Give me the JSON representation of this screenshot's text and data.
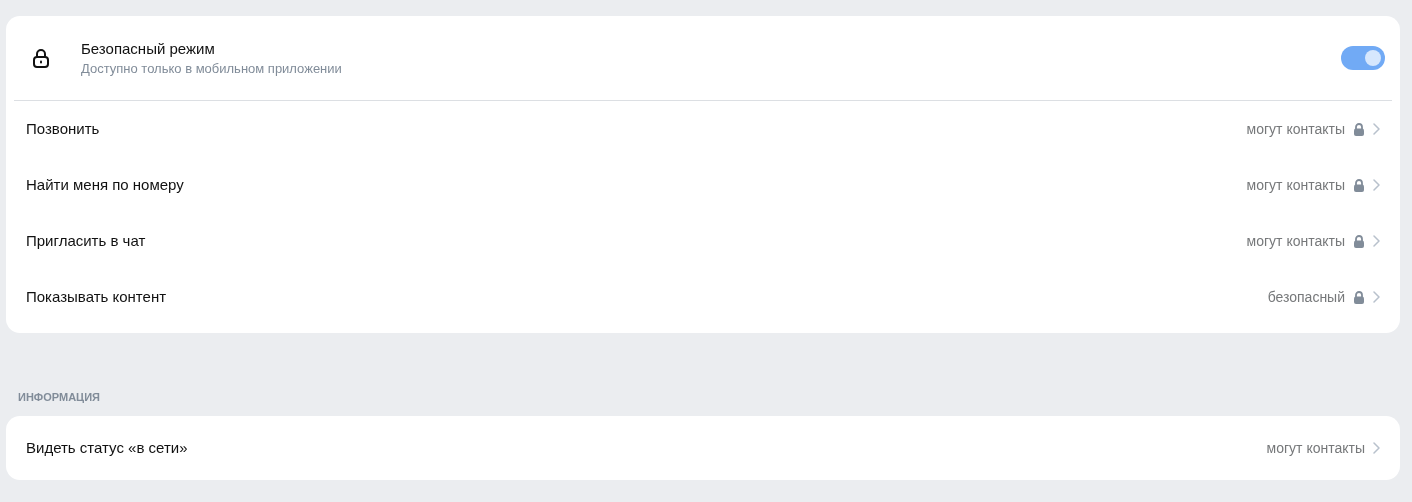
{
  "safe_mode": {
    "title": "Безопасный режим",
    "subtitle": "Доступно только в мобильном приложении",
    "on": true
  },
  "privacy_rows": [
    {
      "label": "Позвонить",
      "value": "могут контакты",
      "locked": true
    },
    {
      "label": "Найти меня по номеру",
      "value": "могут контакты",
      "locked": true
    },
    {
      "label": "Пригласить в чат",
      "value": "могут контакты",
      "locked": true
    },
    {
      "label": "Показывать контент",
      "value": "безопасный",
      "locked": true
    }
  ],
  "info_section": {
    "heading": "ИНФОРМАЦИЯ",
    "rows": [
      {
        "label": "Видеть статус «в сети»",
        "value": "могут контакты",
        "locked": false
      }
    ]
  }
}
